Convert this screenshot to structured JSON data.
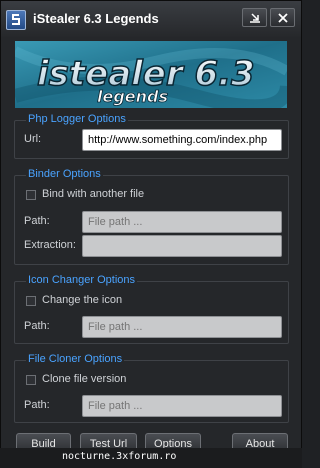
{
  "window": {
    "title": "iStealer 6.3 Legends",
    "controls": [
      "restore-icon",
      "close-icon"
    ]
  },
  "banner": {
    "logo_main": "istealer 6.3",
    "logo_sub": "legends"
  },
  "php_logger": {
    "legend": "Php Logger Options",
    "url_label": "Url:",
    "url_value": "http://www.something.com/index.php"
  },
  "binder": {
    "legend": "Binder Options",
    "checkbox_label": "Bind with another file",
    "checked": false,
    "path_label": "Path:",
    "path_placeholder": "File path ...",
    "extraction_label": "Extraction:",
    "extraction_value": ""
  },
  "icon_changer": {
    "legend": "Icon Changer Options",
    "checkbox_label": "Change the icon",
    "checked": false,
    "path_label": "Path:",
    "path_placeholder": "File path ..."
  },
  "file_cloner": {
    "legend": "File Cloner Options",
    "checkbox_label": "Clone file version",
    "checked": false,
    "path_label": "Path:",
    "path_placeholder": "File path ..."
  },
  "buttons": {
    "build": "Build",
    "test_url": "Test Url",
    "options": "Options",
    "about": "About"
  },
  "footer": {
    "watermark": "nocturne.3xforum.ro"
  },
  "colors": {
    "accent": "#4aa3ff",
    "window_bg": "#25272a",
    "banner_bg": "#2b7f98"
  }
}
